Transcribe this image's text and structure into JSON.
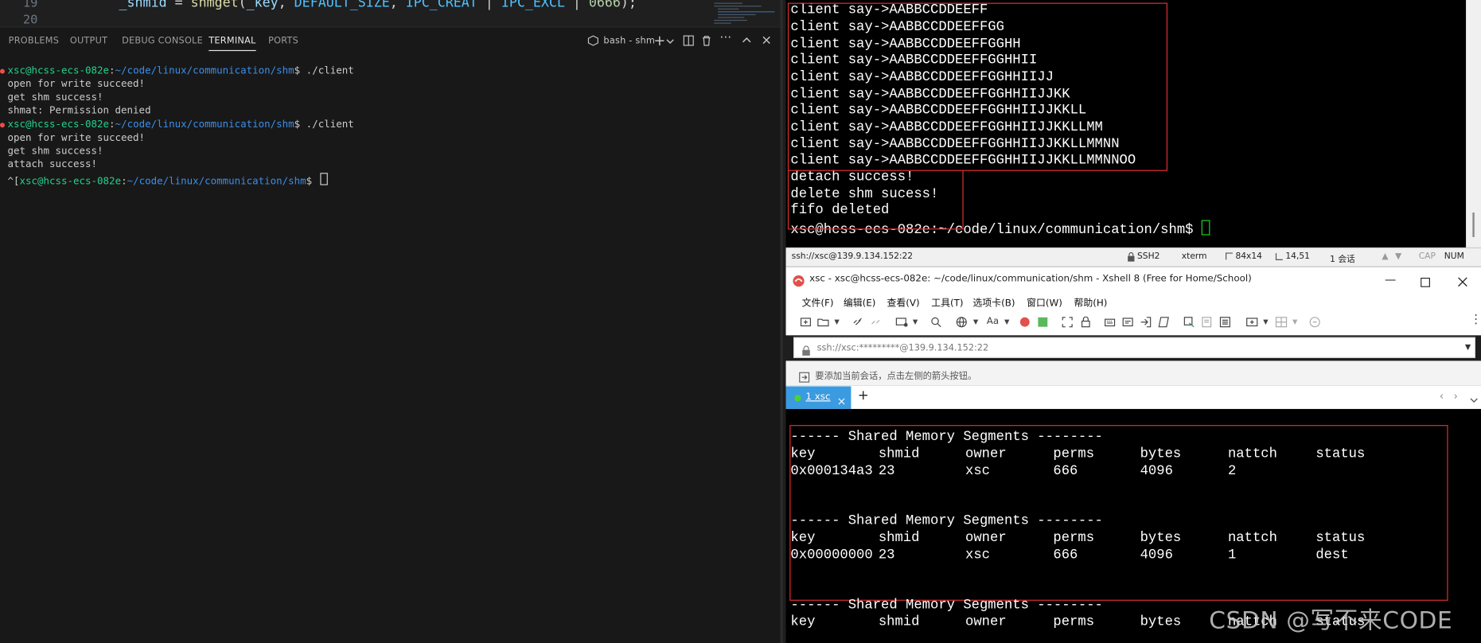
{
  "editor": {
    "line_19": "19",
    "line_20": "20",
    "code": {
      "indent_var": "_shmid",
      "assign": " = ",
      "fn": "shmget",
      "open": "(",
      "arg1": "_key",
      "comma1": ", ",
      "arg2": "DEFAULT_SIZE",
      "comma2": ", ",
      "arg3": "IPC_CREAT",
      "pipe1": " | ",
      "arg4": "IPC_EXCL",
      "pipe2": " | ",
      "arg5": "0666",
      "close": ");"
    }
  },
  "panel": {
    "tabs": [
      "PROBLEMS",
      "OUTPUT",
      "DEBUG CONSOLE",
      "TERMINAL",
      "PORTS"
    ],
    "active_tab": "TERMINAL",
    "shell_label": "bash - shm",
    "icons": [
      "terminal-icon",
      "plus-icon",
      "chevron-down-icon",
      "split-icon",
      "trash-icon",
      "more-icon",
      "chevron-up-icon",
      "close-icon"
    ]
  },
  "vscode_terminal": {
    "prompt_user": "xsc@hcss-ecs-082e",
    "prompt_path": "~/code/linux/communication/shm",
    "prompt_suffix": "$",
    "cmd1": "./client",
    "out1": [
      "open for write succeed!",
      "get shm success!",
      "shmat: Permission denied"
    ],
    "cmd2": "./client",
    "out2": [
      "open for write succeed!",
      "get shm success!",
      "attach success!"
    ],
    "last_prefix": "^[",
    "last_user": "xsc@hcss-ecs-082e",
    "last_path": "~/code/linux/communication/shm"
  },
  "server_terminal": {
    "lines": [
      "client say->AABBCCDDEEFF",
      "client say->AABBCCDDEEFFGG",
      "client say->AABBCCDDEEFFGGHH",
      "client say->AABBCCDDEEFFGGHHII",
      "client say->AABBCCDDEEFFGGHHIIJJ",
      "client say->AABBCCDDEEFFGGHHIIJJKK",
      "client say->AABBCCDDEEFFGGHHIIJJKKLL",
      "client say->AABBCCDDEEFFGGHHIIJJKKLLMM",
      "client say->AABBCCDDEEFFGGHHIIJJKKLLMMNN",
      "client say->AABBCCDDEEFFGGHHIIJJKKLLMMNNOO",
      "detach success!",
      "delete shm sucess!",
      "fifo deleted"
    ],
    "prompt": "xsc@hcss-ecs-082e:~/code/linux/communication/shm$ "
  },
  "statusbar": {
    "connection": "ssh://xsc@139.9.134.152:22",
    "protocol": "SSH2",
    "term": "xterm",
    "size": "84x14",
    "cursor_pos": "14,51",
    "sessions": "1 会话",
    "cap": "CAP",
    "num": "NUM"
  },
  "xshell": {
    "title": "xsc - xsc@hcss-ecs-082e: ~/code/linux/communication/shm - Xshell 8 (Free for Home/School)",
    "menu": [
      "文件(F)",
      "编辑(E)",
      "查看(V)",
      "工具(T)",
      "选项卡(B)",
      "窗口(W)",
      "帮助(H)"
    ],
    "address": "ssh://xsc:*********@139.9.134.152:22",
    "hint": "要添加当前会话，点击左侧的箭头按钮。",
    "tab_label": "1 xsc",
    "add_tab": "+"
  },
  "ipcs": {
    "header": "------ Shared Memory Segments --------",
    "columns": [
      "key",
      "shmid",
      "owner",
      "perms",
      "bytes",
      "nattch",
      "status"
    ],
    "blocks": [
      [
        "0x000134a3",
        "23",
        "xsc",
        "666",
        "4096",
        "2",
        ""
      ],
      [
        "0x00000000",
        "23",
        "xsc",
        "666",
        "4096",
        "1",
        "dest"
      ]
    ]
  },
  "watermark": "CSDN @写不来CODE"
}
